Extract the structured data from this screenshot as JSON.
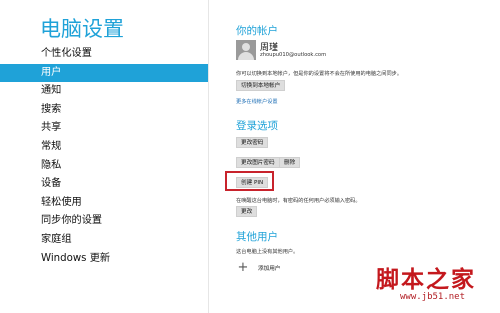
{
  "sidebar": {
    "title": "电脑设置",
    "items": [
      {
        "label": "个性化设置",
        "active": false
      },
      {
        "label": "用户",
        "active": true
      },
      {
        "label": "通知",
        "active": false
      },
      {
        "label": "搜索",
        "active": false
      },
      {
        "label": "共享",
        "active": false
      },
      {
        "label": "常规",
        "active": false
      },
      {
        "label": "隐私",
        "active": false
      },
      {
        "label": "设备",
        "active": false
      },
      {
        "label": "轻松使用",
        "active": false
      },
      {
        "label": "同步你的设置",
        "active": false
      },
      {
        "label": "家庭组",
        "active": false
      },
      {
        "label": "Windows 更新",
        "active": false
      }
    ]
  },
  "account": {
    "header": "你的帐户",
    "name": "周瑾",
    "email": "zhoupu010@outlook.com",
    "description": "你可以切换到本地帐户，但是你的设置将不会在所使用的电脑之间同步。",
    "switch_button": "切换到本地帐户",
    "more_link": "更多在线帐户设置"
  },
  "signin": {
    "header": "登录选项",
    "change_password": "更改密码",
    "change_picture_password": "更改图片密码",
    "delete": "删除",
    "create_pin": "创建 PIN",
    "wake_description": "在唤醒这台电脑时，有密码的任何用户必须输入密码。",
    "change": "更改"
  },
  "other_users": {
    "header": "其他用户",
    "description": "这台电脑上没有其他用户。",
    "add_user": "添加用户"
  },
  "watermark": {
    "text": "脚本之家",
    "url": "www.jb51.net"
  },
  "colors": {
    "accent": "#1fa2d8",
    "highlight_border": "#c8232c"
  }
}
